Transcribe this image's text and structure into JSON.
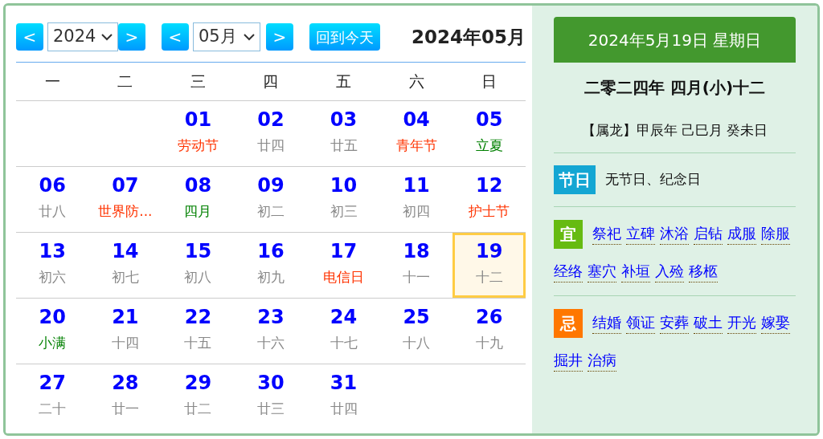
{
  "toolbar": {
    "year_prev": "<",
    "year": "2024",
    "year_next": ">",
    "month_prev": "<",
    "month": "05月",
    "month_next": ">",
    "today_button": "回到今天",
    "title": "2024年05月"
  },
  "weekdays": [
    "一",
    "二",
    "三",
    "四",
    "五",
    "六",
    "日"
  ],
  "days": [
    {
      "day": "01",
      "sub": "劳动节",
      "kind": "holiday",
      "selected": false
    },
    {
      "day": "02",
      "sub": "廿四",
      "kind": "lunar",
      "selected": false
    },
    {
      "day": "03",
      "sub": "廿五",
      "kind": "lunar",
      "selected": false
    },
    {
      "day": "04",
      "sub": "青年节",
      "kind": "holiday",
      "selected": false
    },
    {
      "day": "05",
      "sub": "立夏",
      "kind": "solar_term",
      "selected": false
    },
    {
      "day": "06",
      "sub": "廿八",
      "kind": "lunar",
      "selected": false
    },
    {
      "day": "07",
      "sub": "世界防...",
      "kind": "holiday",
      "selected": false
    },
    {
      "day": "08",
      "sub": "四月",
      "kind": "solar_term",
      "selected": false
    },
    {
      "day": "09",
      "sub": "初二",
      "kind": "lunar",
      "selected": false
    },
    {
      "day": "10",
      "sub": "初三",
      "kind": "lunar",
      "selected": false
    },
    {
      "day": "11",
      "sub": "初四",
      "kind": "lunar",
      "selected": false
    },
    {
      "day": "12",
      "sub": "护士节",
      "kind": "holiday",
      "selected": false
    },
    {
      "day": "13",
      "sub": "初六",
      "kind": "lunar",
      "selected": false
    },
    {
      "day": "14",
      "sub": "初七",
      "kind": "lunar",
      "selected": false
    },
    {
      "day": "15",
      "sub": "初八",
      "kind": "lunar",
      "selected": false
    },
    {
      "day": "16",
      "sub": "初九",
      "kind": "lunar",
      "selected": false
    },
    {
      "day": "17",
      "sub": "电信日",
      "kind": "holiday",
      "selected": false
    },
    {
      "day": "18",
      "sub": "十一",
      "kind": "lunar",
      "selected": false
    },
    {
      "day": "19",
      "sub": "十二",
      "kind": "lunar",
      "selected": true
    },
    {
      "day": "20",
      "sub": "小满",
      "kind": "solar_term",
      "selected": false
    },
    {
      "day": "21",
      "sub": "十四",
      "kind": "lunar",
      "selected": false
    },
    {
      "day": "22",
      "sub": "十五",
      "kind": "lunar",
      "selected": false
    },
    {
      "day": "23",
      "sub": "十六",
      "kind": "lunar",
      "selected": false
    },
    {
      "day": "24",
      "sub": "十七",
      "kind": "lunar",
      "selected": false
    },
    {
      "day": "25",
      "sub": "十八",
      "kind": "lunar",
      "selected": false
    },
    {
      "day": "26",
      "sub": "十九",
      "kind": "lunar",
      "selected": false
    },
    {
      "day": "27",
      "sub": "二十",
      "kind": "lunar",
      "selected": false
    },
    {
      "day": "28",
      "sub": "廿一",
      "kind": "lunar",
      "selected": false
    },
    {
      "day": "29",
      "sub": "廿二",
      "kind": "lunar",
      "selected": false
    },
    {
      "day": "30",
      "sub": "廿三",
      "kind": "lunar",
      "selected": false
    },
    {
      "day": "31",
      "sub": "廿四",
      "kind": "lunar",
      "selected": false
    }
  ],
  "detail": {
    "date_header": "2024年5月19日 星期日",
    "lunar_date": "二零二四年 四月(小)十二",
    "ganzhi": "【属龙】甲辰年 己巳月 癸未日",
    "festival": {
      "badge": "节日",
      "text": "无节日、纪念日"
    },
    "sections": [
      {
        "kind": "good",
        "badge": "宜",
        "items": [
          "祭祀",
          "立碑",
          "沐浴",
          "启钻",
          "成服",
          "除服",
          "经络",
          "塞穴",
          "补垣",
          "入殓",
          "移柩"
        ]
      },
      {
        "kind": "bad",
        "badge": "忌",
        "items": [
          "结婚",
          "领证",
          "安葬",
          "破土",
          "开光",
          "嫁娶",
          "掘井",
          "治病"
        ]
      }
    ]
  }
}
